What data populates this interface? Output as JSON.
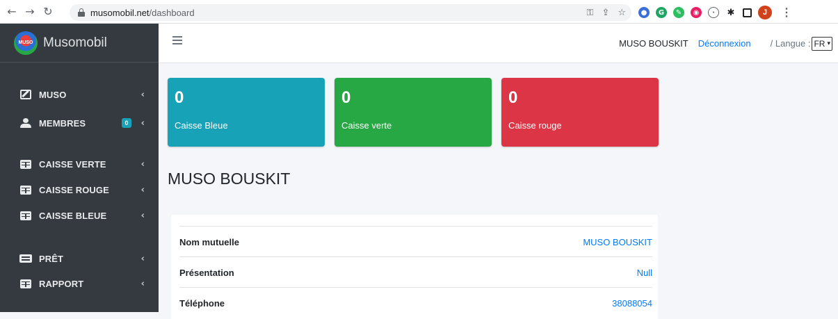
{
  "browser": {
    "url_host": "musomobil.net",
    "url_path": "/dashboard",
    "profile_initial": "J"
  },
  "sidebar": {
    "brand": "Musomobil",
    "logo_text": "MUSO",
    "items": [
      {
        "label": "MUSO",
        "icon": "edit-icon"
      },
      {
        "label": "MEMBRES",
        "icon": "users-icon",
        "badge": "0"
      },
      {
        "label": "CAISSE VERTE",
        "icon": "table-icon"
      },
      {
        "label": "CAISSE ROUGE",
        "icon": "table-icon"
      },
      {
        "label": "CAISSE BLEUE",
        "icon": "table-icon"
      },
      {
        "label": "PRÊT",
        "icon": "money-icon"
      },
      {
        "label": "RAPPORT",
        "icon": "table-icon"
      }
    ]
  },
  "topbar": {
    "user": "MUSO BOUSKIT",
    "logout": "Déconnexion",
    "lang_label": "/ Langue :",
    "lang_value": "FR"
  },
  "boxes": [
    {
      "value": "0",
      "label": "Caisse Bleue",
      "color": "#17a2b8"
    },
    {
      "value": "0",
      "label": "Caisse verte",
      "color": "#28a745"
    },
    {
      "value": "0",
      "label": "Caisse rouge",
      "color": "#dc3545"
    }
  ],
  "main": {
    "title": "MUSO BOUSKIT",
    "info": [
      {
        "label": "Nom mutuelle",
        "value": "MUSO BOUSKIT"
      },
      {
        "label": "Présentation",
        "value": "Null"
      },
      {
        "label": "Téléphone",
        "value": "38088054"
      }
    ]
  }
}
